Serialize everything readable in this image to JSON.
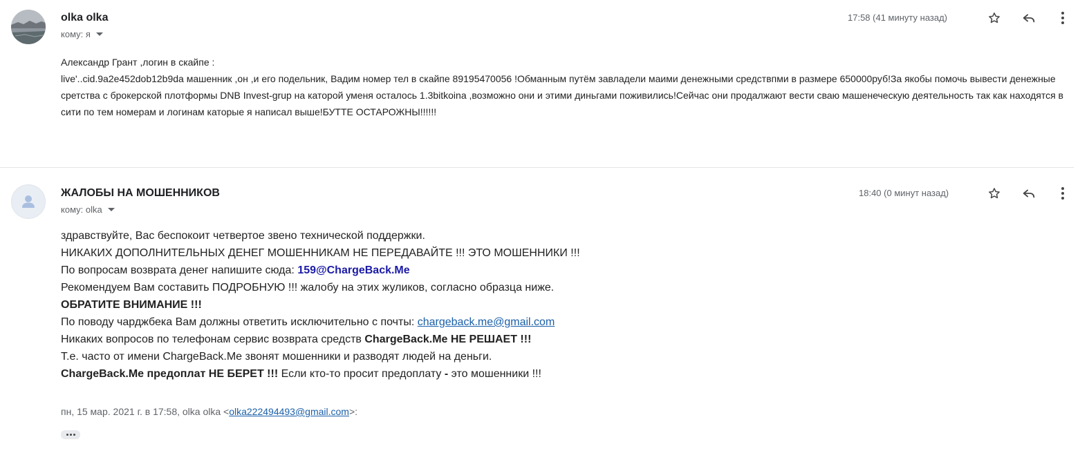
{
  "messages": [
    {
      "sender": "olka olka",
      "recipient": "кому: я",
      "timestamp": "17:58 (41 минуту назад)",
      "body": [
        "Александр Грант ,логин в скайпе :",
        "live'..cid.9a2e452dob12b9da машенник ,он ,и его подельник, Вадим номер тел в скайпе 89195470056 !Обманным путём завладели маими денежными средствпми в  размере 650000руб!За якобы помочь вывести денежные сретства с брокерской плотформы DNB Invest-grup на каторой уменя осталось 1.3bitkoina ,возможно они и этими диньгами поживились!Сейчас они продалжают вести сваю машенеческую деятельность так как находятся в сити по тем номерам и логинам каторые я написал выше!БУТТЕ ОСТАРОЖНЫ!!!!!!"
      ]
    },
    {
      "sender": "ЖАЛОБЫ НА МОШЕННИКОВ",
      "recipient": "кому: olka",
      "timestamp": "18:40 (0 минут назад)",
      "lines": {
        "l1": "здравствуйте, Вас беспокоит четвертое звено технической поддержки.",
        "l2": "НИКАКИХ ДОПОЛНИТЕЛЬНЫХ ДЕНЕГ МОШЕННИКАМ НЕ ПЕРЕДАВАЙТЕ !!! ЭТО МОШЕННИКИ !!!",
        "l3_text": "По вопросам возврата денег напишите сюда: ",
        "l3_email": "159@ChargeBack.Me",
        "l4": "Рекомендуем Вам составить ПОДРОБНУЮ !!! жалобу на этих жуликов, согласно образца ниже.",
        "l5": "ОБРАТИТЕ ВНИМАНИЕ !!!",
        "l6_text": "По поводу чарджбека Вам должны ответить исключительно с почты: ",
        "l6_link": "chargeback.me@gmail.com",
        "l7_text": "Никаких вопросов по телефонам сервис возврата средств ",
        "l7_bold": "ChargeBack.Me НЕ РЕШАЕТ !!!",
        "l8": "Т.е. часто от имени ChargeBack.Me звонят мошенники и разводят людей на деньги.",
        "l9_bold": "ChargeBack.Me предоплат НЕ БЕРЕТ !!!",
        "l9_text": " Если кто-то просит предоплату ",
        "l9_dash": "-",
        "l9_tail": " это мошенники !!!"
      },
      "quote": {
        "prefix": "пн, 15 мар. 2021 г. в 17:58, olka olka <",
        "email": "olka222494493@gmail.com",
        "suffix": ">:"
      }
    }
  ],
  "icons": {
    "star": "star-icon",
    "reply": "reply-icon",
    "more": "more-vert-icon",
    "avatar_default": "person-icon",
    "caret": "chevron-down-icon"
  },
  "colors": {
    "link": "#1a5fa8",
    "strong_email": "#1a1aa6",
    "meta_text": "#5f6368"
  }
}
